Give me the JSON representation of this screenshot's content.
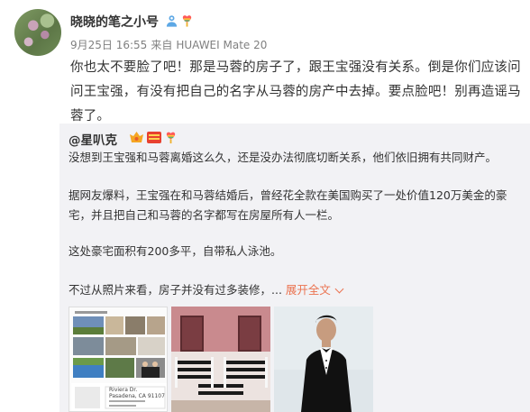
{
  "post": {
    "username": "晓晓的笔之小号",
    "date": "9月25日 16:55",
    "source_prefix": "来自",
    "device": "HUAWEI Mate 20",
    "text": "你也太不要脸了吧！那是马蓉的房子了，跟王宝强没有关系。倒是你们应该问问王宝强，有没有把自己的名字从马蓉的房产中去掉。要点脸吧！别再造谣马蓉了。",
    "badges": [
      "user-badge-icon",
      "rainbow-heart-icon"
    ]
  },
  "repost": {
    "author": "@星叭克",
    "author_badges": [
      "vip-badge-icon",
      "emblem-badge-icon",
      "rainbow-heart-icon"
    ],
    "paragraphs": [
      "没想到王宝强和马蓉离婚这么久，还是没办法彻底切断关系，他们依旧拥有共同财产。",
      "据网友爆料，王宝强在和马蓉结婚后，曾经花全款在美国购买了一处价值120万美金的豪宅，并且把自己和马蓉的名字都写在房屋所有人一栏。",
      "这处豪宅面积有200多平，自带私人泳池。",
      "不过从照片来看，房子并没有过多装修，"
    ],
    "ellipsis": "...",
    "expand_label": "展开全文",
    "images": [
      {
        "name": "house-listing-image",
        "caption_street": "Riviera Dr.",
        "caption_city": "Pasadena, CA 91107"
      },
      {
        "name": "nursery-room-image"
      },
      {
        "name": "man-in-tuxedo-image"
      }
    ]
  },
  "colors": {
    "link": "#eb7350",
    "meta": "#808080",
    "repost_bg": "#f2f2f5"
  }
}
